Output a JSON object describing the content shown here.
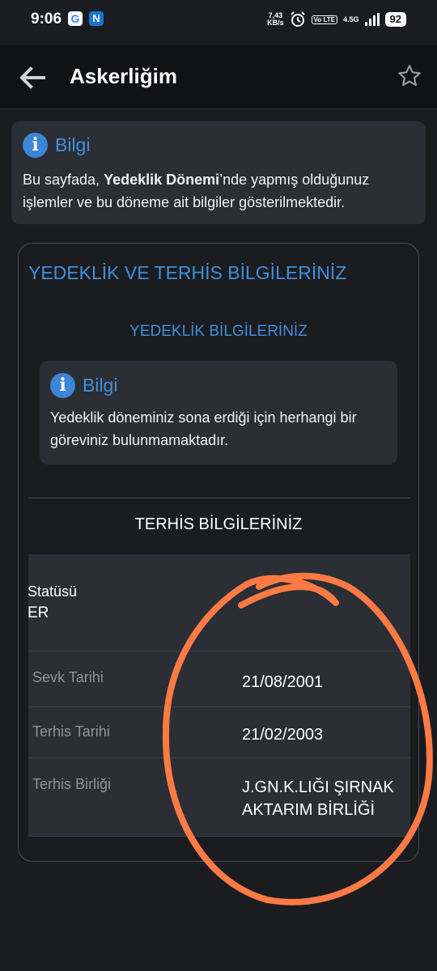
{
  "status_bar": {
    "time": "9:06",
    "google_badge": "G",
    "notification_badge": "N",
    "speed_value": "7,43",
    "speed_unit": "KB/s",
    "volte": "Vo LTE",
    "network": "4.5G",
    "battery": "92"
  },
  "header": {
    "title": "Askerliğim",
    "back_icon": "arrow-left-icon",
    "favorite_icon": "star-outline-icon"
  },
  "info_top": {
    "icon": "info-icon",
    "label": "Bilgi",
    "text_pre": "Bu sayfada, ",
    "text_bold": "Yedeklik Dönemi",
    "text_post": "’nde yapmış olduğunuz işlemler ve bu döneme ait bilgiler gösterilmektedir."
  },
  "section": {
    "title": "YEDEKLİK VE TERHİS BİLGİLERİNİZ",
    "yedeklik_title": "YEDEKLİK BİLGİLERİNİZ",
    "inner_info": {
      "label": "Bilgi",
      "text": "Yedeklik döneminiz sona erdiği için herhangi bir göreviniz bulunmamaktadır."
    },
    "terhis_title": "TERHİS BİLGİLERİNİZ"
  },
  "table": {
    "status_label": "Statüsü",
    "status_value": "ER",
    "rows": [
      {
        "label": "Sevk Tarihi",
        "value": "21/08/2001"
      },
      {
        "label": "Terhis Tarihi",
        "value": "21/02/2003"
      },
      {
        "label": "Terhis Birliği",
        "value": "J.GN.K.LIĞI ŞIRNAK AKTARIM BİRLİĞİ"
      }
    ]
  },
  "colors": {
    "background": "#1b1c20",
    "card": "#2b2e34",
    "accent_blue": "#3f8fdc",
    "annotation": "#ff7a45"
  }
}
